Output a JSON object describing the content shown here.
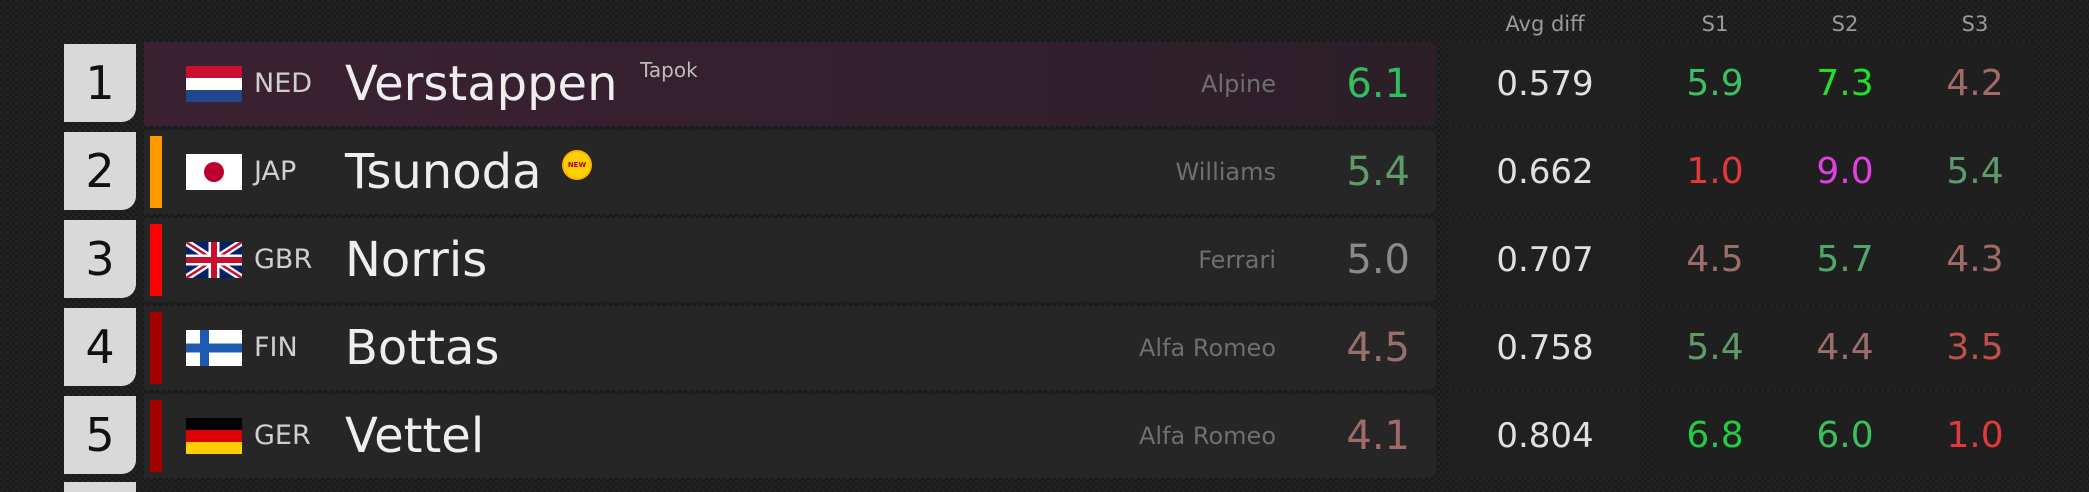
{
  "headers": {
    "avg_diff": "Avg diff",
    "s1": "S1",
    "s2": "S2",
    "s3": "S3"
  },
  "rows": [
    {
      "pos": "1",
      "code": "NED",
      "name": "Verstappen",
      "tag": "Tapok",
      "team": "Alpine",
      "score": "6.1",
      "score_color": "#2fbf5e",
      "avg": "0.579",
      "bar_color": "",
      "s1": "5.9",
      "s1_color": "#3fbf63",
      "s2": "7.3",
      "s2_color": "#22e022",
      "s3": "4.2",
      "s3_color": "#a06a66",
      "flag_icon": "netherlands-flag-icon"
    },
    {
      "pos": "2",
      "code": "JAP",
      "name": "Tsunoda",
      "badge": "NEW",
      "team": "Williams",
      "score": "5.4",
      "score_color": "#5e9a6a",
      "avg": "0.662",
      "bar_color": "#ff9900",
      "s1": "1.0",
      "s1_color": "#e23a3a",
      "s2": "9.0",
      "s2_color": "#e040e0",
      "s3": "5.4",
      "s3_color": "#5e9a6a",
      "flag_icon": "japan-flag-icon"
    },
    {
      "pos": "3",
      "code": "GBR",
      "name": "Norris",
      "team": "Ferrari",
      "score": "5.0",
      "score_color": "#8a8a8a",
      "avg": "0.707",
      "bar_color": "#ff0000",
      "s1": "4.5",
      "s1_color": "#9a6e6b",
      "s2": "5.7",
      "s2_color": "#4fa86a",
      "s3": "4.3",
      "s3_color": "#a06a66",
      "flag_icon": "uk-flag-icon"
    },
    {
      "pos": "4",
      "code": "FIN",
      "name": "Bottas",
      "team": "Alfa Romeo",
      "score": "4.5",
      "score_color": "#9a6e6b",
      "avg": "0.758",
      "bar_color": "#a30000",
      "s1": "5.4",
      "s1_color": "#5e9a6a",
      "s2": "4.4",
      "s2_color": "#9a6e6b",
      "s3": "3.5",
      "s3_color": "#c0504a",
      "flag_icon": "finland-flag-icon"
    },
    {
      "pos": "5",
      "code": "GER",
      "name": "Vettel",
      "team": "Alfa Romeo",
      "score": "4.1",
      "score_color": "#a06a66",
      "avg": "0.804",
      "bar_color": "#a30000",
      "s1": "6.8",
      "s1_color": "#22cc44",
      "s2": "6.0",
      "s2_color": "#3bbf5e",
      "s3": "1.0",
      "s3_color": "#e23a3a",
      "flag_icon": "germany-flag-icon"
    }
  ]
}
